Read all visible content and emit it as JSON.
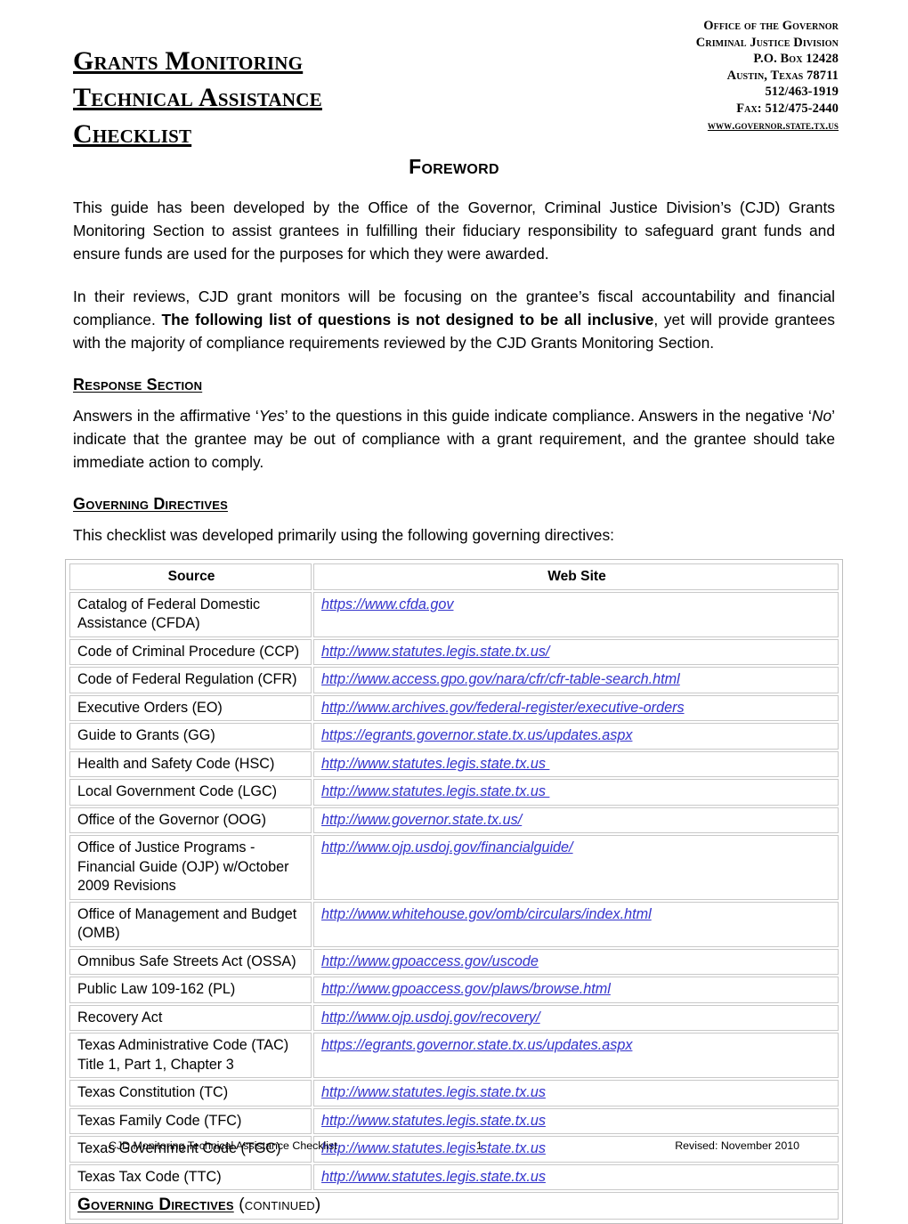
{
  "document": {
    "title_lines": [
      "Grants Monitoring",
      "Technical Assistance",
      "Checklist"
    ],
    "org_header": [
      "Office of the Governor",
      "Criminal Justice Division",
      "P.O. Box 12428",
      "Austin, Texas 78711",
      "512/463-1919",
      "Fax: 512/475-2440",
      "www.governor.state.tx.us"
    ]
  },
  "foreword": {
    "heading": "Foreword",
    "paragraph_1": "This guide has been developed by the Office of the Governor, Criminal Justice Division’s (CJD) Grants Monitoring Section to assist grantees in fulfilling their fiduciary responsibility to safeguard grant funds and ensure funds are used for the purposes for which they were awarded.",
    "paragraph_2_part_1": "In their reviews, CJD grant monitors will be focusing on the grantee’s fiscal accountability and financial compliance.  ",
    "paragraph_2_bold": "The following list of questions is not designed to be all inclusive",
    "paragraph_2_part_2": ", yet will provide grantees with the majority of compliance requirements reviewed by the CJD Grants Monitoring Section."
  },
  "response_section": {
    "heading": "Response Section",
    "text_part_1": "Answers in the affirmative ‘",
    "italic_yes": "Yes",
    "text_part_2": "’ to the questions in this guide indicate compliance.  Answers in the negative ‘",
    "italic_no": "No",
    "text_part_3": "’ indicate that the grantee may be out of compliance with a grant requirement, and the grantee should take immediate action to comply."
  },
  "governing_directives": {
    "heading": "Governing Directives",
    "intro": "This checklist was developed primarily using the following governing directives:",
    "table": {
      "columns": [
        "Source",
        "Web Site"
      ],
      "rows": [
        {
          "source": "Catalog of Federal Domestic Assistance (CFDA)",
          "url": "https://www.cfda.gov",
          "small": false
        },
        {
          "source": "Code of Criminal Procedure (CCP)",
          "url": "http://www.statutes.legis.state.tx.us/",
          "small": false
        },
        {
          "source": "Code of Federal Regulation (CFR)",
          "url": "http://www.access.gpo.gov/nara/cfr/cfr-table-search.html",
          "small": false
        },
        {
          "source": "Executive Orders (EO)",
          "url": "http://www.archives.gov/federal-register/executive-orders",
          "small": false
        },
        {
          "source": "Guide to Grants (GG)",
          "url": "https://egrants.governor.state.tx.us/updates.aspx",
          "small": false
        },
        {
          "source": "Health and Safety Code (HSC)",
          "url": "http://www.statutes.legis.state.tx.us ",
          "small": false
        },
        {
          "source": "Local Government Code (LGC)",
          "url": "http://www.statutes.legis.state.tx.us ",
          "small": false
        },
        {
          "source": "Office of the Governor (OOG)",
          "url": "http://www.governor.state.tx.us/",
          "small": false
        },
        {
          "source": "Office of Justice Programs - Financial Guide (OJP) w/October 2009 Revisions",
          "url": "http://www.ojp.usdoj.gov/financialguide/",
          "small": false
        },
        {
          "source": "Office of Management and Budget (OMB)",
          "url": "http://www.whitehouse.gov/omb/circulars/index.html",
          "small": false
        },
        {
          "source": "Omnibus Safe Streets Act (OSSA)",
          "url": "http://www.gpoaccess.gov/uscode",
          "small": false
        },
        {
          "source": "Public Law 109-162 (PL)",
          "url": "http://www.gpoaccess.gov/plaws/browse.html",
          "small": false
        },
        {
          "source": "Recovery Act",
          "url": "http://www.ojp.usdoj.gov/recovery/",
          "small": false
        },
        {
          "source": "Texas Administrative Code (TAC) Title 1, Part 1, Chapter 3",
          "url": "https://egrants.governor.state.tx.us/updates.aspx",
          "small": true
        },
        {
          "source": "Texas Constitution (TC)",
          "url": "http://www.statutes.legis.state.tx.us",
          "small": false
        },
        {
          "source": "Texas Family Code (TFC)",
          "url": "http://www.statutes.legis.state.tx.us",
          "small": false
        },
        {
          "source": "Texas Government Code (TGC)",
          "url": "http://www.statutes.legis.state.tx.us",
          "small": false
        },
        {
          "source": "Texas Tax Code (TTC)",
          "url": "http://www.statutes.legis.state.tx.us",
          "small": false
        }
      ],
      "continued_row": {
        "bold_text": "Governing Directives",
        "normal_text": " (continued)"
      }
    }
  },
  "footer": {
    "left": "CJD Monitoring Technical Assistance Checklist",
    "page_number": "1",
    "right": "Revised: November 2010"
  },
  "colors": {
    "link": "#3333cc",
    "text": "#000000",
    "table_border": "#c9c9c9"
  }
}
